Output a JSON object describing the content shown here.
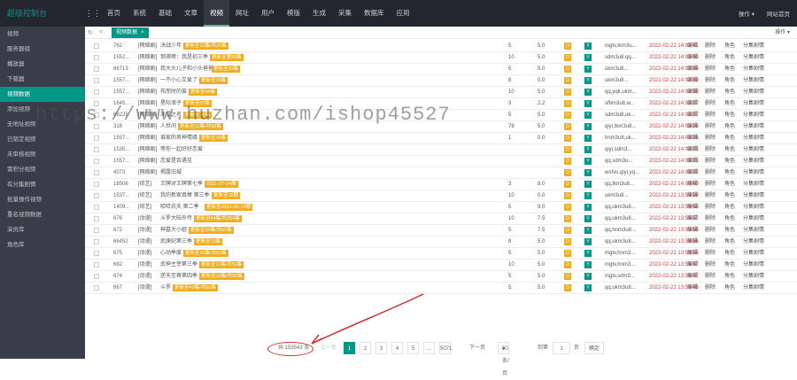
{
  "app": {
    "title": "超级控制台"
  },
  "nav": {
    "items": [
      "首页",
      "系统",
      "基础",
      "文章",
      "视频",
      "网址",
      "用户",
      "模版",
      "生成",
      "采集",
      "数据库",
      "应用"
    ],
    "active_index": 4,
    "right": {
      "ops_label": "操作",
      "site_label": "网站首页"
    }
  },
  "sidebar": {
    "items": [
      "视频",
      "服务器组",
      "播放器",
      "下载器",
      "视频数据",
      "添加视频",
      "无地址视频",
      "已锁定视频",
      "未审核视频",
      "需积分视频",
      "有分集剧情",
      "批量操作视频",
      "重名视频数据",
      "演员库",
      "角色库"
    ],
    "active_index": 4
  },
  "tabbar": {
    "tab_label": "视频数据",
    "close": "×",
    "ops_label": "操作",
    "refresh": "↻",
    "back": "<"
  },
  "rows": [
    {
      "id": "762",
      "cat": "[网络剧]",
      "title": "决战少年",
      "badge": "更新至12集/共20集",
      "n1": "5",
      "score": "5.0",
      "user": "mgtv,tkm3u...",
      "time": "2022-02-22 14:02:41"
    },
    {
      "id": "1552...",
      "cat": "[网络剧]",
      "title": "琅琊榜：我是初三季",
      "badge": "更新至第58集",
      "n1": "10",
      "score": "5.0",
      "user": "sdm3u8.qq...",
      "time": "2022-02-22 14:02:40"
    },
    {
      "id": "66713",
      "cat": "[网络剧]",
      "title": "我大头儿子和小头爸爸 真人版第三季",
      "badge": "更新至20集",
      "n1": "5",
      "score": "5.0",
      "user": "ukm3u8...",
      "time": "2022-02-22 14:02:39"
    },
    {
      "id": "1557...",
      "cat": "[网络剧]",
      "title": "一不小心又爱了",
      "badge": "更新至16集",
      "n1": "8",
      "score": "0.0",
      "user": "ukm3u8...",
      "time": "2022-02-22 14:02:39"
    },
    {
      "id": "1557...",
      "cat": "[网络剧]",
      "title": "布而时的爱",
      "badge": "更新至04集",
      "n1": "10",
      "score": "5.0",
      "user": "qq,yqk,ukm...",
      "time": "2022-02-22 14:02:39"
    },
    {
      "id": "1645...",
      "cat": "[网络剧]",
      "title": "星际浪子",
      "badge": "更新至07集",
      "n1": "3",
      "score": "2.2",
      "user": "sfbm3u8,w...",
      "time": "2022-02-22 14:02:27"
    },
    {
      "id": "66225",
      "cat": "[网络剧]",
      "title": "冰雪之名",
      "badge": "更新至16集",
      "n1": "5",
      "score": "5.0",
      "user": "sdm3u8,uk...",
      "time": "2022-02-22 14:02:27"
    },
    {
      "id": "318",
      "cat": "[网络剧]",
      "title": "人世间",
      "badge": "更新至12集/共58集",
      "n1": "78",
      "score": "5.0",
      "user": "qiyi,tkm3u8...",
      "time": "2022-02-22 14:02:26"
    },
    {
      "id": "1557...",
      "cat": "[网络剧]",
      "title": "谁家的男神情缘",
      "badge": "更新至16集",
      "n1": "1",
      "score": "0.0",
      "user": "hnm3u8,uk...",
      "time": "2022-02-22 14:02:26"
    },
    {
      "id": "1535...",
      "cat": "[网络剧]",
      "title": "等你一起好好恋爱",
      "badge": "",
      "n1": "",
      "score": "",
      "user": "qiyi,sdm3...",
      "time": "2022-02-22 14:02:23"
    },
    {
      "id": "1557...",
      "cat": "[网络剧]",
      "title": "恋爱是否遇见",
      "badge": "",
      "n1": "",
      "score": "",
      "user": "qq,sdm3u...",
      "time": "2022-02-22 14:02:23"
    },
    {
      "id": "4073",
      "cat": "[网络剧]",
      "title": "揭露旧城",
      "badge": "",
      "n1": "",
      "score": "",
      "user": "wsfvu,qiyi,yq...",
      "time": "2022-02-22 14:02:22"
    },
    {
      "id": "18506",
      "cat": "[综艺]",
      "title": "王牌对王牌第七季",
      "badge": "2021-07-04期",
      "n1": "3",
      "score": "8.0",
      "user": "qq,tkm3u8...",
      "time": "2022-02-22 14:00:00"
    },
    {
      "id": "1537...",
      "cat": "[综艺]",
      "title": "我的新家真棒 第三季",
      "badge": "更新至16期",
      "n1": "10",
      "score": "0.0",
      "user": "ukm3u8...",
      "time": "2022-02-22 13:59:59"
    },
    {
      "id": "1409...",
      "cat": "[综艺]",
      "title": "哈哈农夫 第二季",
      "badge": "更新至2021-05-14期",
      "n1": "5",
      "score": "9.0",
      "user": "qq,ukm3u8...",
      "time": "2022-02-22 13:59:58"
    },
    {
      "id": "676",
      "cat": "[动漫]",
      "title": "斗罗大陆外传",
      "badge": "更新至54集/共254集",
      "n1": "10",
      "score": "7.5",
      "user": "qq,ukm3u8...",
      "time": "2022-02-22 13:59:57"
    },
    {
      "id": "672",
      "cat": "[动漫]",
      "title": "神墓大小姐",
      "badge": "更新至20集/共60集",
      "n1": "5",
      "score": "7.5",
      "user": "qq,hnm3u8...",
      "time": "2022-02-22 13:59:56"
    },
    {
      "id": "66452",
      "cat": "[动漫]",
      "title": "武庚纪第三季",
      "badge": "更新至13集",
      "n1": "8",
      "score": "5.0",
      "user": "qq,ukm3u8...",
      "time": "2022-02-22 13:59:56"
    },
    {
      "id": "675",
      "cat": "[动漫]",
      "title": "心动季度",
      "badge": "更新至16集/共52集",
      "n1": "5",
      "score": "5.0",
      "user": "mgtv,hnm3...",
      "time": "2022-02-22 13:59:55"
    },
    {
      "id": "682",
      "cat": "[动漫]",
      "title": "武神主宰第三季",
      "badge": "更新至11集/共50集",
      "n1": "10",
      "score": "5.0",
      "user": "mgtv,hnm3...",
      "time": "2022-02-22 13:59:47"
    },
    {
      "id": "674",
      "cat": "[动漫]",
      "title": "逆天至尊第四季",
      "badge": "更新至19集/共50集",
      "n1": "5",
      "score": "5.0",
      "user": "mgtv,sdm3...",
      "time": "2022-02-22 13:59:47"
    },
    {
      "id": "667",
      "cat": "[动漫]",
      "title": "斗罗",
      "badge": "更新至45集/共60集",
      "n1": "5",
      "score": "5.0",
      "user": "qq,ukm3u8...",
      "time": "2022-02-22 13:59:46"
    }
  ],
  "row_actions": {
    "edit": "编辑",
    "delete": "删除",
    "role": "角色",
    "plot": "分集剧情",
    "o_mark": "O",
    "y_mark": "Y"
  },
  "pagination": {
    "total": "共 153543 条",
    "prev": "上一页",
    "pages": [
      "1",
      "2",
      "3",
      "4",
      "5",
      "...",
      "5071"
    ],
    "active_page": "1",
    "next": "下一页",
    "per_page": "50 条/页",
    "goto_label": "到第",
    "goto_value": "1",
    "page_unit": "页",
    "confirm": "确定"
  },
  "watermark": "https://www.huzhan.com/ishop45527",
  "colors": {
    "accent": "#009688",
    "topbar": "#23262e",
    "sidebar": "#393d49",
    "badge": "#f0ad1e",
    "time": "#e4393c",
    "annotation": "#d32f2f"
  }
}
